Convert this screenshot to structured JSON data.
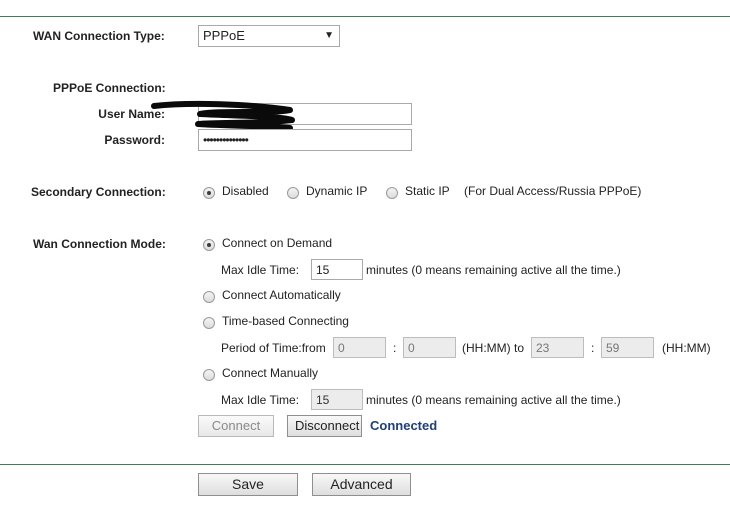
{
  "wan": {
    "label": "WAN Connection Type:",
    "selected": "PPPoE"
  },
  "pppoe": {
    "section_label": "PPPoE Connection:",
    "user_label": "User Name:",
    "user_value": "",
    "password_label": "Password:",
    "password_value": "••••••••••••••"
  },
  "secondary": {
    "label": "Secondary Connection:",
    "options": [
      "Disabled",
      "Dynamic IP",
      "Static IP"
    ],
    "selected_index": 0,
    "note": "(For Dual Access/Russia PPPoE)"
  },
  "mode": {
    "label": "Wan Connection Mode:",
    "on_demand": "Connect on Demand",
    "max_idle_label": "Max Idle Time:",
    "max_idle_value": "15",
    "idle_note": "minutes (0 means remaining active all the time.)",
    "automatic": "Connect Automatically",
    "time_based": "Time-based Connecting",
    "period_label": "Period of Time:from",
    "from_hh": "0",
    "colon": ":",
    "from_mm": "0",
    "to_label": "(HH:MM) to",
    "to_hh": "23",
    "to_mm": "59",
    "hhmm": "(HH:MM)",
    "manual": "Connect Manually",
    "manual_idle_label": "Max Idle Time:",
    "manual_idle_value": "15",
    "manual_idle_note": "minutes (0 means remaining active all the time.)"
  },
  "actions": {
    "connect": "Connect",
    "disconnect": "Disconnect",
    "status": "Connected",
    "save": "Save",
    "advanced": "Advanced"
  }
}
